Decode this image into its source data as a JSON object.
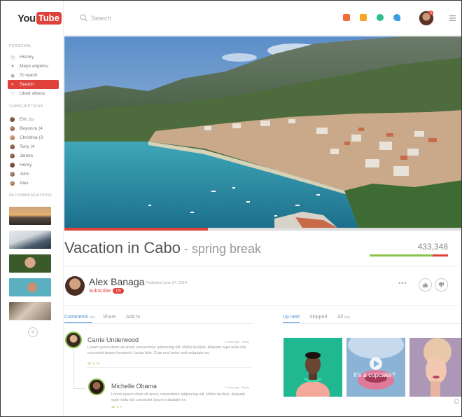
{
  "sidebar": {
    "logo_you": "You",
    "logo_tube": "Tube",
    "personal_heading": "PERSONAL",
    "personal": [
      {
        "label": "History",
        "icon": "history-icon"
      },
      {
        "label": "Maya angelou",
        "icon": "user-icon"
      },
      {
        "label": "To watch",
        "icon": "eye-icon"
      },
      {
        "label": "Search",
        "icon": "search-icon"
      },
      {
        "label": "Liked videos",
        "icon": "heart-icon"
      }
    ],
    "subscriptions_heading": "SUBSCRIPTIONS",
    "subscriptions": [
      "Eric zu",
      "Beyonce (4",
      "Christina (3",
      "Tony (4",
      "James",
      "Henry",
      "John",
      "Alex"
    ],
    "recommendations_heading": "RECOMMENDATIONS",
    "add_label": "+"
  },
  "topbar": {
    "search_placeholder": "Search",
    "notification_badge": "3"
  },
  "video": {
    "progress": 0.36,
    "title": "Vacation in Cabo",
    "subtitle": " - spring break",
    "views": "433,348",
    "like_ratio": 0.8
  },
  "channel": {
    "name": "Alex Banaga",
    "published": "Published june 27, 2014",
    "subscribe_label": "Subscribe",
    "subscriber_count": "13k"
  },
  "tabs": {
    "comments_label": "Comments",
    "comments_count": "(26)",
    "share_label": "Share",
    "add_label": "Add to",
    "upnext_label": "Up next",
    "skipped_label": "Skipped",
    "all_label": "All",
    "all_count": "(89)"
  },
  "comments": [
    {
      "name": "Carrie Underwood",
      "time": "2 hours ago · Reply",
      "text": "Lorem ipsum dolor sit amet, consectetur adipiscing elit. Mollis facilisis. Aliquam eget nulla nisi consectet ipsum hendrerit, luctus felis. Cras erat tortor sed vulputate ex.",
      "stats": "16 ·0 ·11"
    },
    {
      "name": "Michelle Obama",
      "time": "2 hours ago · Reply",
      "text": "Lorem ipsum dolor sit amet, consectetur adipiscing elit. Mollis facilisis. Aliquam eget nulla nisi consectet ipsum vulputate ex.",
      "stats": "10 ·0 ·7"
    }
  ],
  "upnext": {
    "card2_text": "It's a cupcake?"
  },
  "colors": {
    "accent": "#e0413b",
    "link": "#4a8fd6",
    "positive": "#8bc34a"
  }
}
